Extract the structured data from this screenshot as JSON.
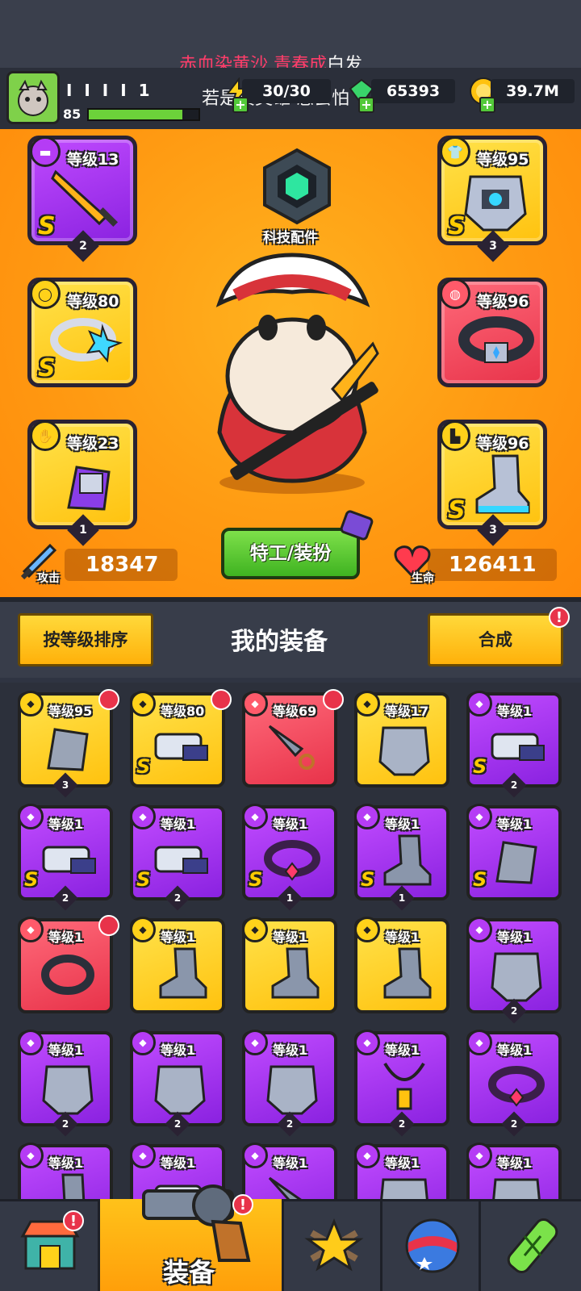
{
  "lyrics": {
    "line1_red": "赤血染黄沙 青春成",
    "line1_white": "白发",
    "line2": "若是真英雄 怎会怕"
  },
  "player": {
    "name": "I I I I 1",
    "level": "85",
    "xp_progress": 0.85
  },
  "resources": {
    "energy": "30/30",
    "gems": "65393",
    "coins": "39.7M"
  },
  "tech_part": {
    "label": "科技配件"
  },
  "equipped": {
    "weapon": {
      "level": "等级13",
      "grade": "S",
      "stars": "2",
      "icon": "weapon-icon"
    },
    "ring": {
      "level": "等级80",
      "grade": "S",
      "stars": "",
      "icon": "ring-icon"
    },
    "glove": {
      "level": "等级23",
      "grade": "",
      "stars": "1",
      "icon": "glove-icon"
    },
    "armor": {
      "level": "等级95",
      "grade": "S",
      "stars": "3",
      "icon": "armor-icon"
    },
    "belt": {
      "level": "等级96",
      "grade": "",
      "stars": "",
      "icon": "belt-icon"
    },
    "boots": {
      "level": "等级96",
      "grade": "S",
      "stars": "3",
      "icon": "boots-icon"
    }
  },
  "stats": {
    "attack_label": "攻击",
    "attack": "18347",
    "hp_label": "生命",
    "hp": "126411"
  },
  "agent_button": "特工/装扮",
  "midbar": {
    "sort_button": "按等级排序",
    "title": "我的装备",
    "merge_button": "合成",
    "merge_badge": "!"
  },
  "inventory": [
    {
      "level": "等级95",
      "color": "yellow",
      "grade": "",
      "stars": "3",
      "icon": "glove-icon",
      "cat": "y",
      "tag": true
    },
    {
      "level": "等级80",
      "color": "yellow",
      "grade": "S",
      "stars": "",
      "icon": "weapon-icon",
      "cat": "y",
      "tag": true
    },
    {
      "level": "等级69",
      "color": "red",
      "grade": "",
      "stars": "",
      "icon": "kunai-icon",
      "cat": "r",
      "tag": true
    },
    {
      "level": "等级17",
      "color": "yellow",
      "grade": "",
      "stars": "",
      "icon": "armor-icon",
      "cat": "y",
      "tag": false
    },
    {
      "level": "等级1",
      "color": "purple",
      "grade": "S",
      "stars": "2",
      "icon": "weapon-icon",
      "cat": "p",
      "tag": false
    },
    {
      "level": "等级1",
      "color": "purple",
      "grade": "S",
      "stars": "2",
      "icon": "weapon-icon",
      "cat": "p",
      "tag": false
    },
    {
      "level": "等级1",
      "color": "purple",
      "grade": "S",
      "stars": "2",
      "icon": "weapon-icon",
      "cat": "p",
      "tag": false
    },
    {
      "level": "等级1",
      "color": "purple",
      "grade": "S",
      "stars": "1",
      "icon": "belt-icon",
      "cat": "p",
      "tag": false
    },
    {
      "level": "等级1",
      "color": "purple",
      "grade": "S",
      "stars": "1",
      "icon": "boots-icon",
      "cat": "p",
      "tag": false
    },
    {
      "level": "等级1",
      "color": "purple",
      "grade": "S",
      "stars": "",
      "icon": "glove-icon",
      "cat": "p",
      "tag": false
    },
    {
      "level": "等级1",
      "color": "red",
      "grade": "",
      "stars": "",
      "icon": "ring-icon",
      "cat": "r",
      "tag": true
    },
    {
      "level": "等级1",
      "color": "yellow",
      "grade": "",
      "stars": "",
      "icon": "boots-icon",
      "cat": "y",
      "tag": false
    },
    {
      "level": "等级1",
      "color": "yellow",
      "grade": "",
      "stars": "",
      "icon": "boots-icon",
      "cat": "y",
      "tag": false
    },
    {
      "level": "等级1",
      "color": "yellow",
      "grade": "",
      "stars": "",
      "icon": "boots-icon",
      "cat": "y",
      "tag": false
    },
    {
      "level": "等级1",
      "color": "purple",
      "grade": "",
      "stars": "2",
      "icon": "armor-icon",
      "cat": "p",
      "tag": false
    },
    {
      "level": "等级1",
      "color": "purple",
      "grade": "",
      "stars": "2",
      "icon": "armor-icon",
      "cat": "p",
      "tag": false
    },
    {
      "level": "等级1",
      "color": "purple",
      "grade": "",
      "stars": "2",
      "icon": "armor-icon",
      "cat": "p",
      "tag": false
    },
    {
      "level": "等级1",
      "color": "purple",
      "grade": "",
      "stars": "2",
      "icon": "armor-icon",
      "cat": "p",
      "tag": false
    },
    {
      "level": "等级1",
      "color": "purple",
      "grade": "",
      "stars": "2",
      "icon": "necklace-icon",
      "cat": "p",
      "tag": false
    },
    {
      "level": "等级1",
      "color": "purple",
      "grade": "",
      "stars": "2",
      "icon": "belt-icon",
      "cat": "p",
      "tag": false
    },
    {
      "level": "等级1",
      "color": "purple",
      "grade": "",
      "stars": "",
      "icon": "boots-icon",
      "cat": "p",
      "tag": false
    },
    {
      "level": "等级1",
      "color": "purple",
      "grade": "",
      "stars": "",
      "icon": "weapon-icon",
      "cat": "p",
      "tag": false
    },
    {
      "level": "等级1",
      "color": "purple",
      "grade": "",
      "stars": "",
      "icon": "kunai-icon",
      "cat": "p",
      "tag": false
    },
    {
      "level": "等级1",
      "color": "purple",
      "grade": "",
      "stars": "",
      "icon": "armor-icon",
      "cat": "p",
      "tag": false
    },
    {
      "level": "等级1",
      "color": "purple",
      "grade": "",
      "stars": "",
      "icon": "armor-icon",
      "cat": "p",
      "tag": false
    }
  ],
  "nav": {
    "shop_badge": "!",
    "equipment_label": "装备",
    "equipment_badge": "!"
  },
  "colors": {
    "yellow": "#ffc20f",
    "purple": "#9a2ee8",
    "red": "#e8334a",
    "hero_bg": "#ff9a12",
    "accent_green": "#3fb321"
  }
}
